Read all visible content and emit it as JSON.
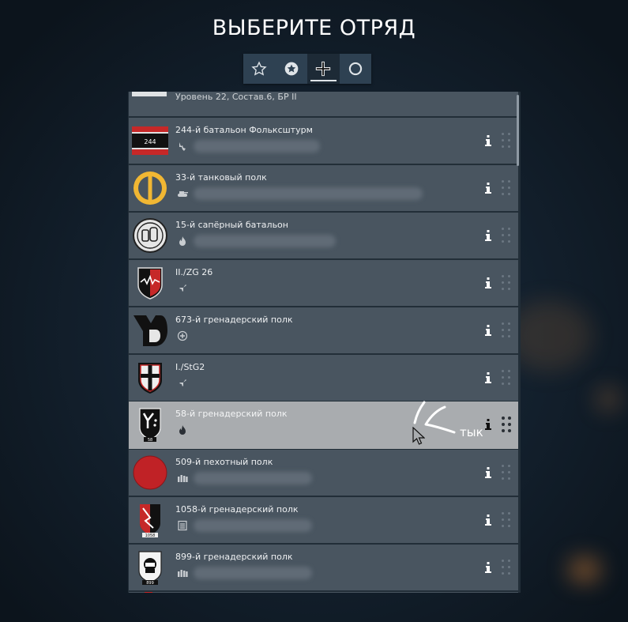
{
  "title": "ВЫБЕРИТЕ ОТРЯД",
  "filter_tabs": [
    {
      "icon": "star-outline-icon",
      "active": false
    },
    {
      "icon": "star-circle-icon",
      "active": false
    },
    {
      "icon": "balkenkreuz-icon",
      "active": true
    },
    {
      "icon": "ring-icon",
      "active": false
    }
  ],
  "partial_top_row": {
    "text": "Уровень 22, Состав.6",
    "suffix": "БР II"
  },
  "squads": [
    {
      "name": "244-й батальон Фольксштурм",
      "type_icon": "infantry-icon",
      "emblem_text": "244"
    },
    {
      "name": "33-й танковый полк",
      "type_icon": "tank-icon"
    },
    {
      "name": "15-й сапёрный батальон",
      "type_icon": "flame-icon"
    },
    {
      "name": "II./ZG 26",
      "type_icon": "aircraft-icon"
    },
    {
      "name": "673-й гренадерский полк",
      "type_icon": "plus-circle-icon"
    },
    {
      "name": "I./StG2",
      "type_icon": "aircraft-icon"
    },
    {
      "name": "58-й гренадерский полк",
      "type_icon": "flame-icon",
      "selected": true,
      "emblem_text": "58"
    },
    {
      "name": "509-й пехотный полк",
      "type_icon": "ammo-icon"
    },
    {
      "name": "1058-й гренадерский полк",
      "type_icon": "list-icon",
      "emblem_text": "1058"
    },
    {
      "name": "899-й гренадерский полк",
      "type_icon": "ammo-icon",
      "emblem_text": "899"
    }
  ],
  "annotation": "тык",
  "colors": {
    "row": "#495560",
    "selected_row": "#a9acaf",
    "bar": "#2e4152"
  }
}
